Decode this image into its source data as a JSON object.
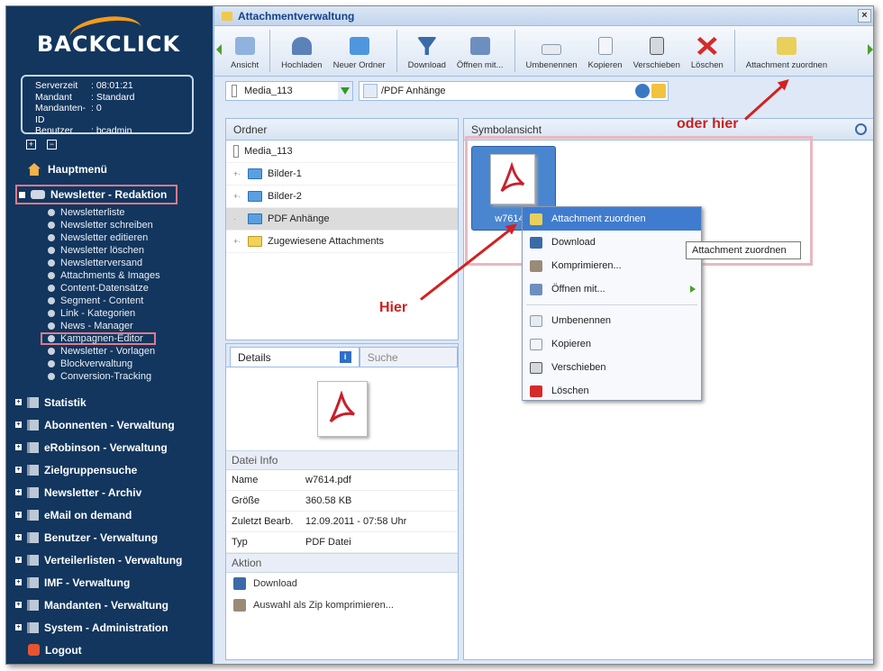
{
  "sidebar": {
    "logo": "BACKCLICK",
    "server": [
      {
        "key": "Serverzeit",
        "value": ": 08:01:21"
      },
      {
        "key": "Mandant",
        "value": ": Standard"
      },
      {
        "key": "Mandanten-ID",
        "value": ": 0"
      },
      {
        "key": "Benutzer",
        "value": ": bcadmin"
      }
    ],
    "home": "Hauptmenü",
    "newsletter_head": "Newsletter - Redaktion",
    "newsletter_items": [
      "Newsletterliste",
      "Newsletter schreiben",
      "Newsletter editieren",
      "Newsletter löschen",
      "Newsletterversand",
      "Attachments & Images",
      "Content-Datensätze",
      "Segment - Content",
      "Link - Kategorien",
      "News - Manager",
      "Kampagnen-Editor",
      "Newsletter - Vorlagen",
      "Blockverwaltung",
      "Conversion-Tracking"
    ],
    "groups": [
      "Statistik",
      "Abonnenten - Verwaltung",
      "eRobinson - Verwaltung",
      "Zielgruppensuche",
      "Newsletter - Archiv",
      "eMail on demand",
      "Benutzer - Verwaltung",
      "Verteilerlisten - Verwaltung",
      "IMF - Verwaltung",
      "Mandanten - Verwaltung",
      "System - Administration"
    ],
    "logout": "Logout"
  },
  "window": {
    "title": "Attachmentverwaltung"
  },
  "toolbar": {
    "ansicht": "Ansicht",
    "hochladen": "Hochladen",
    "neuer_ordner": "Neuer Ordner",
    "download": "Download",
    "oeffnen": "Öffnen mit...",
    "umbenennen": "Umbenennen",
    "kopieren": "Kopieren",
    "verschieben": "Verschieben",
    "loeschen": "Löschen",
    "zuordnen": "Attachment zuordnen"
  },
  "address": {
    "media": "Media_113",
    "path": "/PDF Anhänge"
  },
  "folders": {
    "header": "Ordner",
    "root": "Media_113",
    "items": [
      {
        "label": "Bilder-1"
      },
      {
        "label": "Bilder-2"
      },
      {
        "label": "PDF Anhänge"
      },
      {
        "label": "Zugewiesene Attachments"
      }
    ]
  },
  "details": {
    "tab_details": "Details",
    "tab_suche": "Suche",
    "info_header": "Datei Info",
    "rows": [
      {
        "k": "Name",
        "v": "w7614.pdf"
      },
      {
        "k": "Größe",
        "v": "360.58 KB"
      },
      {
        "k": "Zuletzt Bearb.",
        "v": "12.09.2011 - 07:58 Uhr"
      },
      {
        "k": "Typ",
        "v": "PDF Datei"
      }
    ],
    "action_header": "Aktion",
    "actions": [
      "Download",
      "Auswahl als Zip komprimieren..."
    ]
  },
  "symbol": {
    "header": "Symbolansicht",
    "file_label": "w7614.p"
  },
  "context_menu": {
    "items": [
      "Attachment zuordnen",
      "Download",
      "Komprimieren...",
      "Öffnen mit...",
      "Umbenennen",
      "Kopieren",
      "Verschieben",
      "Löschen"
    ]
  },
  "tooltip": "Attachment zuordnen",
  "annotations": {
    "hier": "Hier",
    "oder_hier": "oder hier"
  },
  "colors": {
    "sidebar": "#12365e",
    "highlight": "#3f7ccf",
    "annotation": "#cc1f1f"
  }
}
